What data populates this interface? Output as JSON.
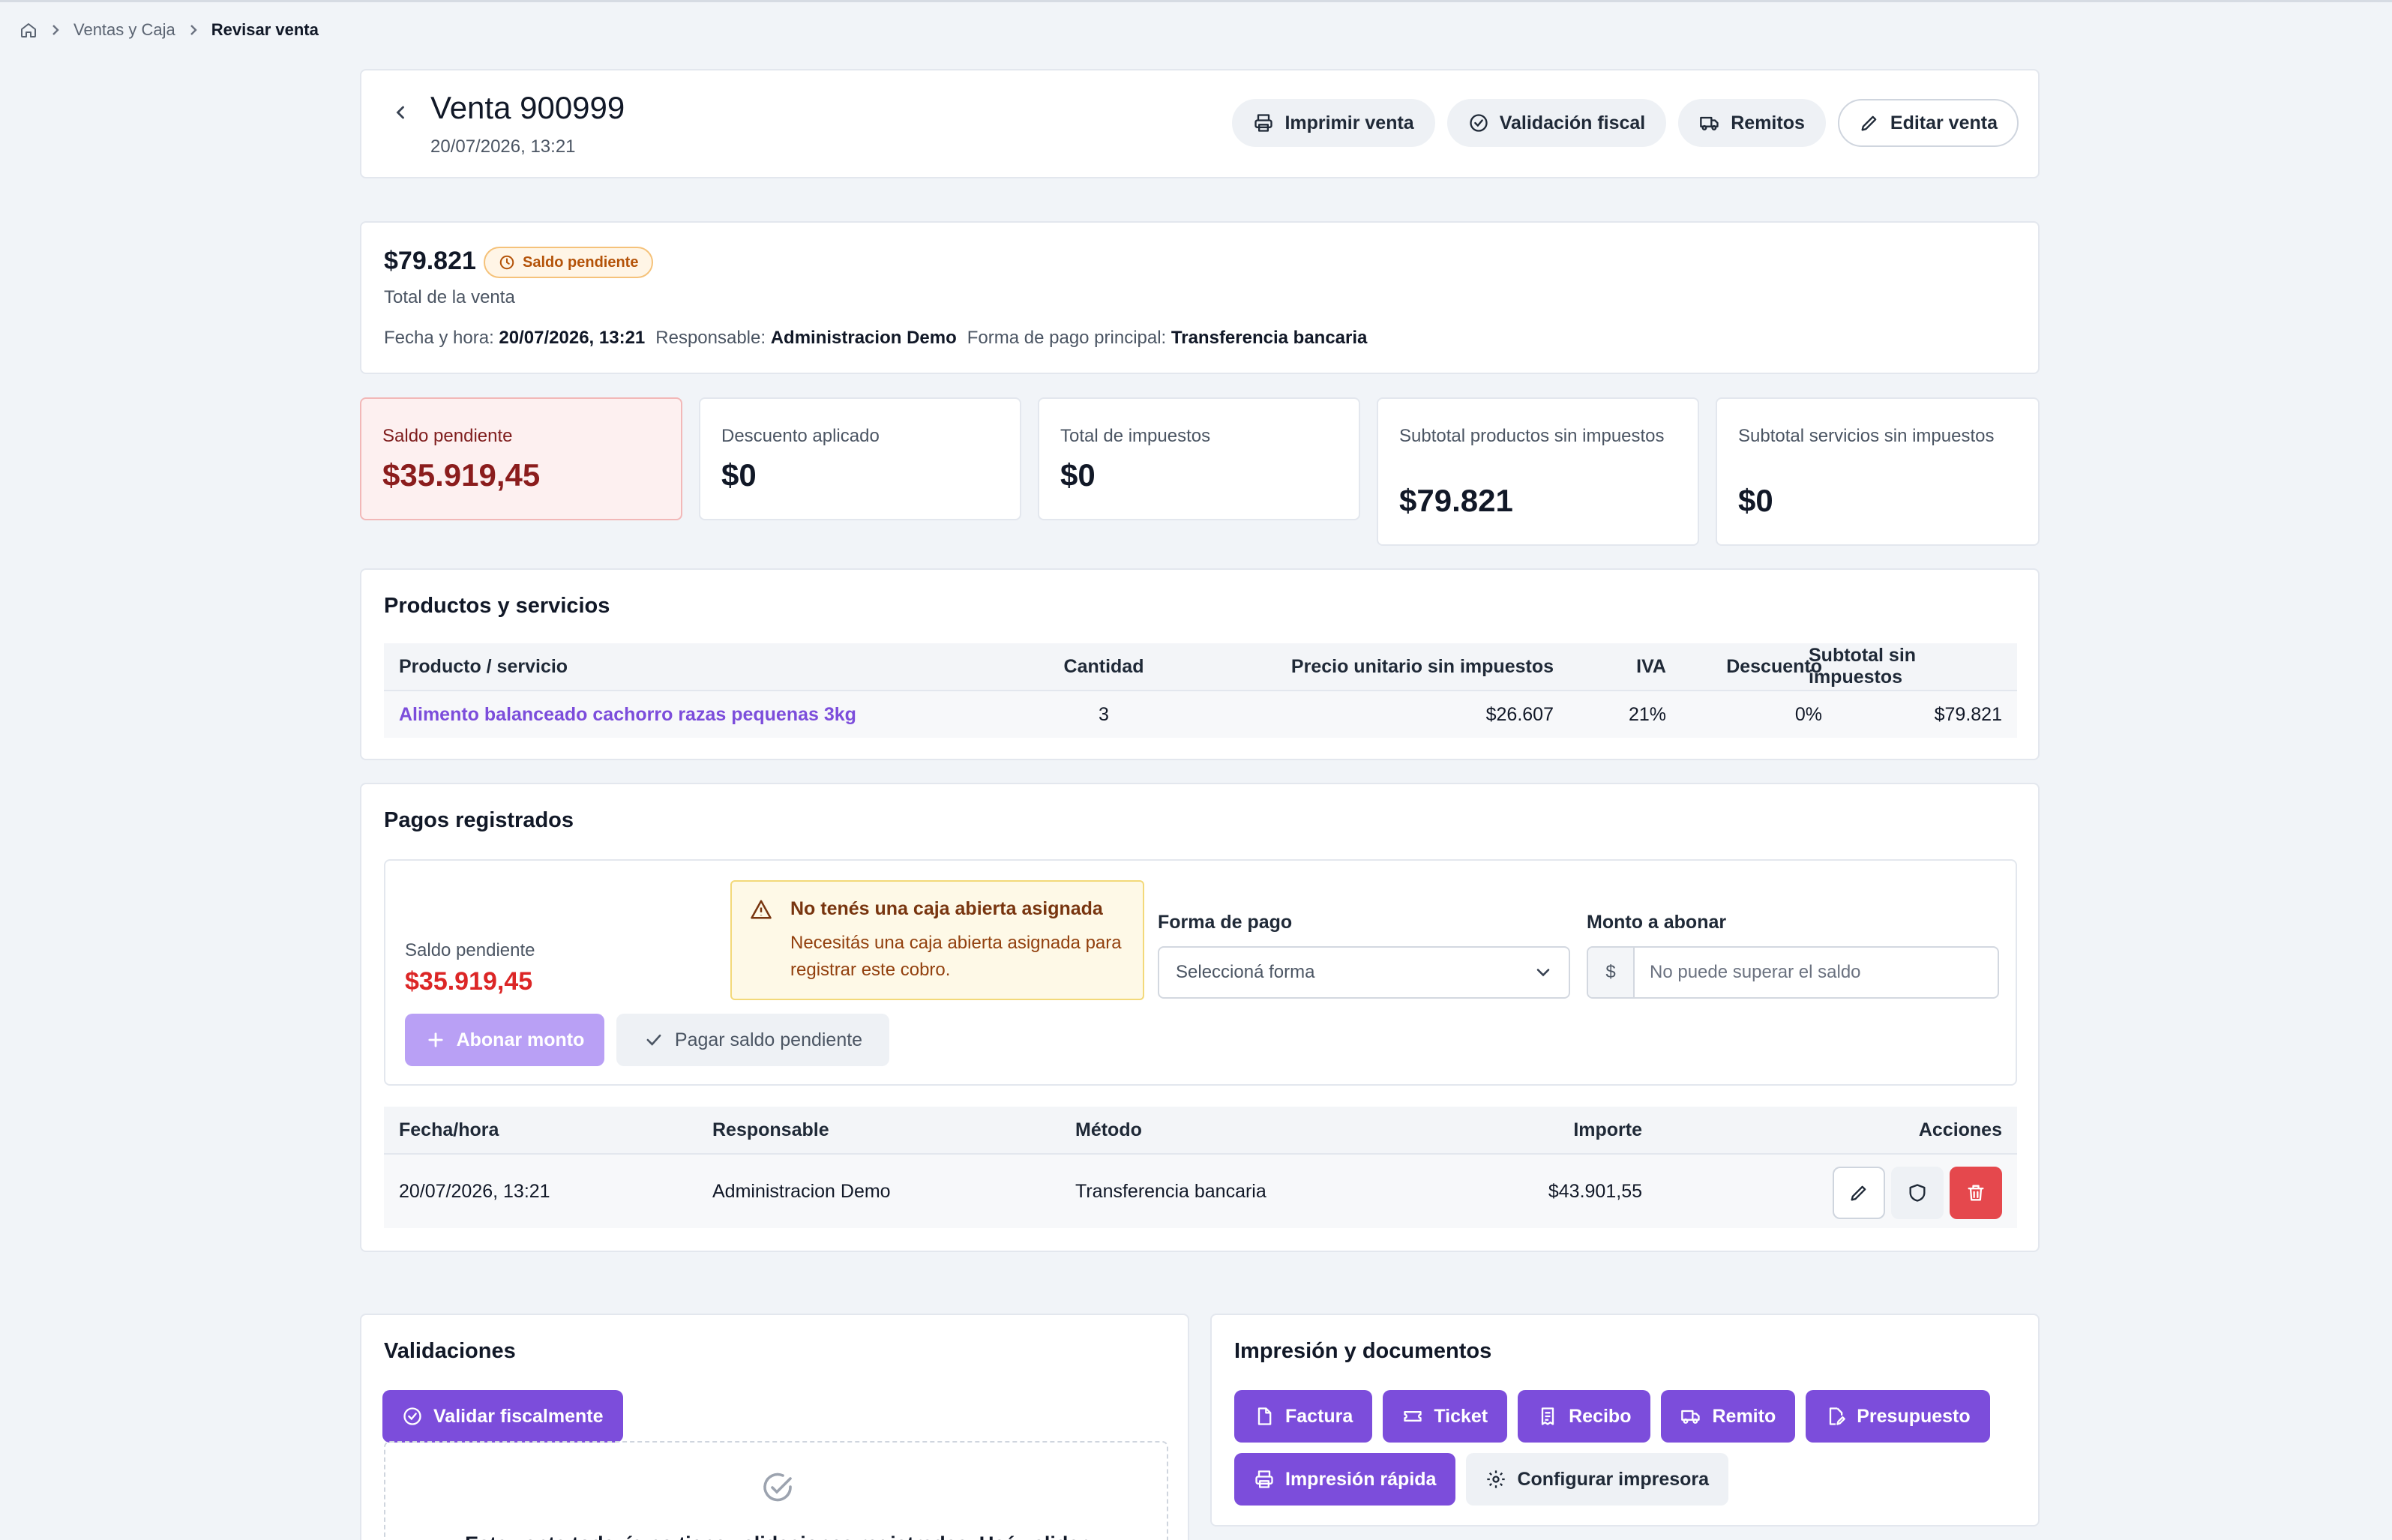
{
  "breadcrumb": {
    "items": [
      "Ventas y Caja"
    ],
    "current": "Revisar venta"
  },
  "header": {
    "title": "Venta 900999",
    "subtitle": "20/07/2026, 13:21",
    "actions": {
      "print": "Imprimir venta",
      "fiscal": "Validación fiscal",
      "remitos": "Remitos",
      "edit": "Editar venta"
    }
  },
  "summary": {
    "total": "$79.821",
    "status": "Saldo pendiente",
    "total_label": "Total de la venta",
    "date_label": "Fecha y hora:",
    "date_value": "20/07/2026, 13:21",
    "resp_label": "Responsable:",
    "resp_value": "Administracion Demo",
    "pay_label": "Forma de pago principal:",
    "pay_value": "Transferencia bancaria"
  },
  "stats": [
    {
      "label": "Saldo pendiente",
      "value": "$35.919,45"
    },
    {
      "label": "Descuento aplicado",
      "value": "$0"
    },
    {
      "label": "Total de impuestos",
      "value": "$0"
    },
    {
      "label": "Subtotal productos sin impuestos",
      "value": "$79.821"
    },
    {
      "label": "Subtotal servicios sin impuestos",
      "value": "$0"
    }
  ],
  "products": {
    "title": "Productos y servicios",
    "columns": [
      "Producto / servicio",
      "Cantidad",
      "Precio unitario sin impuestos",
      "IVA",
      "Descuento",
      "Subtotal sin impuestos"
    ],
    "rows": [
      {
        "name": "Alimento balanceado cachorro razas pequenas 3kg",
        "qty": "3",
        "price": "$26.607",
        "iva": "21%",
        "discount": "0%",
        "subtotal": "$79.821"
      }
    ]
  },
  "payments": {
    "title": "Pagos registrados",
    "saldo_label": "Saldo pendiente",
    "saldo_value": "$35.919,45",
    "abonar_label": "Abonar monto",
    "pagar_label": "Pagar saldo pendiente",
    "alert_title": "No tenés una caja abierta asignada",
    "alert_desc": "Necesitás una caja abierta asignada para registrar este cobro.",
    "forma_label": "Forma de pago",
    "forma_placeholder": "Seleccioná forma",
    "monto_label": "Monto a abonar",
    "monto_prefix": "$",
    "monto_placeholder": "No puede superar el saldo",
    "columns": [
      "Fecha/hora",
      "Responsable",
      "Método",
      "Importe",
      "Acciones"
    ],
    "rows": [
      {
        "date": "20/07/2026, 13:21",
        "resp": "Administracion Demo",
        "method": "Transferencia bancaria",
        "amount": "$43.901,55"
      }
    ]
  },
  "validations": {
    "title": "Validaciones",
    "button": "Validar fiscalmente",
    "empty": "Esta venta todavía no tiene validaciones registradas. Usá validar"
  },
  "printing": {
    "title": "Impresión y documentos",
    "buttons": {
      "factura": "Factura",
      "ticket": "Ticket",
      "recibo": "Recibo",
      "remito": "Remito",
      "presupuesto": "Presupuesto",
      "rapida": "Impresión rápida",
      "config": "Configurar impresora"
    }
  },
  "colors": {
    "accent": "#7c4ddb",
    "danger": "#dc2626",
    "warning": "#b45309",
    "background": "#f1f4f8"
  }
}
